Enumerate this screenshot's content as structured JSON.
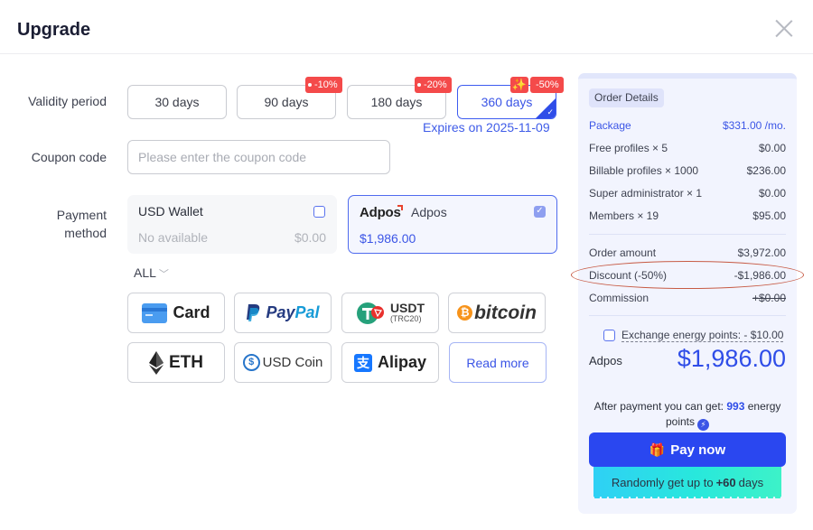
{
  "header": {
    "title": "Upgrade",
    "close_icon": "close-icon"
  },
  "validity": {
    "label": "Validity period",
    "options": [
      {
        "label": "30 days",
        "discount": ""
      },
      {
        "label": "90 days",
        "discount": "-10%"
      },
      {
        "label": "180 days",
        "discount": "-20%"
      },
      {
        "label": "360 days",
        "discount": "-50%",
        "selected": true
      }
    ],
    "spark_icon": "✨",
    "expires": "Expires on 2025-11-09"
  },
  "coupon": {
    "label": "Coupon code",
    "placeholder": "Please enter the coupon code",
    "value": ""
  },
  "payment": {
    "label_line1": "Payment",
    "label_line2": "method",
    "wallet": {
      "name": "USD Wallet",
      "status": "No available",
      "amount": "$0.00",
      "checked": false
    },
    "adpos": {
      "logo": "Adpos",
      "name": "Adpos",
      "amount": "$1,986.00",
      "checked": true
    },
    "filter": "ALL",
    "methods": [
      {
        "name": "Card",
        "icon": "card-icon"
      },
      {
        "name": "PayPal",
        "icon": "paypal-icon"
      },
      {
        "name": "USDT",
        "sub": "(TRC20)",
        "icon": "usdt-icon"
      },
      {
        "name": "bitcoin",
        "icon": "bitcoin-icon"
      },
      {
        "name": "ETH",
        "icon": "ethereum-icon"
      },
      {
        "name": "USD Coin",
        "icon": "usdc-icon"
      },
      {
        "name": "Alipay",
        "icon": "alipay-icon"
      },
      {
        "name": "Read more",
        "icon": ""
      }
    ]
  },
  "order": {
    "badge": "Order Details",
    "package": {
      "label": "Package",
      "value": "$331.00 /mo."
    },
    "items": [
      {
        "label": "Free profiles × 5",
        "value": "$0.00"
      },
      {
        "label": "Billable profiles × 1000",
        "value": "$236.00"
      },
      {
        "label": "Super administrator × 1",
        "value": "$0.00"
      },
      {
        "label": "Members × 19",
        "value": "$95.00"
      }
    ],
    "order_amount": {
      "label": "Order amount",
      "value": "$3,972.00"
    },
    "discount": {
      "label": "Discount (-50%)",
      "value": "-$1,986.00"
    },
    "commission": {
      "label": "Commission",
      "value": "+$0.00"
    },
    "exchange": {
      "label": "Exchange energy points: - $10.00",
      "checked": false
    },
    "pay_method": "Adpos",
    "total": "$1,986.00",
    "after_prefix": "After payment you can get:",
    "energy_points": "993",
    "after_suffix": "energy points",
    "pay_button": "Pay now",
    "promo_prefix": "Randomly get up to",
    "promo_value": "+60",
    "promo_suffix": "days"
  }
}
